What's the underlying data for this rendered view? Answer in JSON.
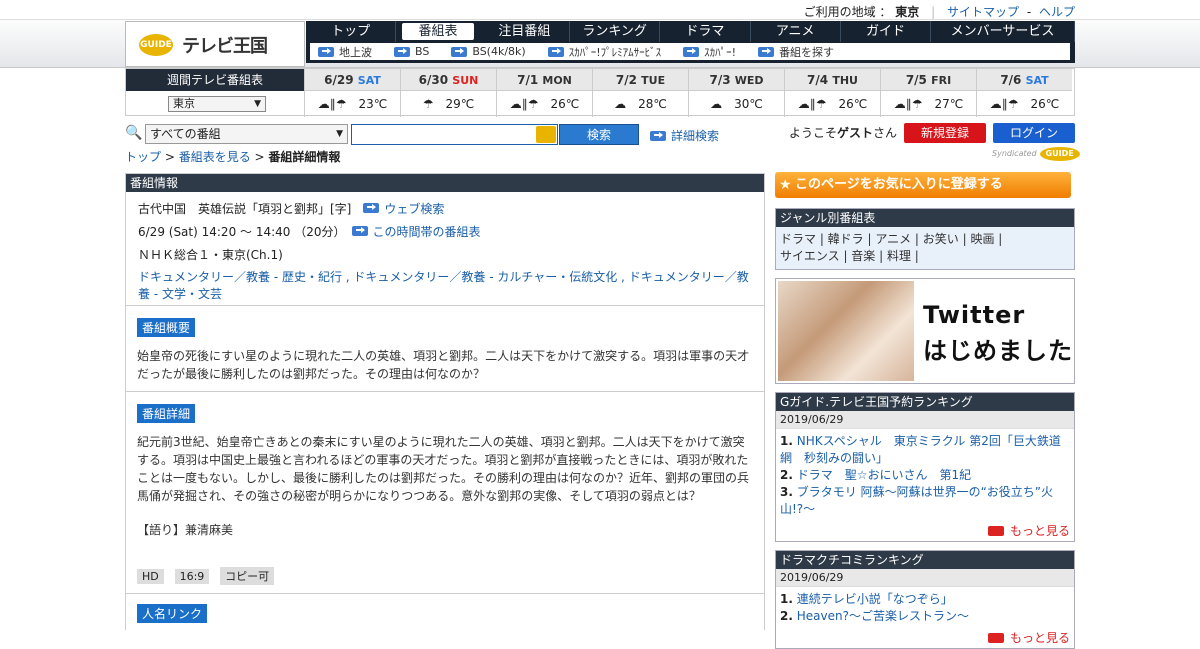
{
  "util": {
    "region_label": "ご利用の地域 ：",
    "region": "東京",
    "sitemap": "サイトマップ",
    "help": "ヘルプ"
  },
  "logo": {
    "g": "GUIDE",
    "text": "テレビ王国"
  },
  "nav": {
    "items": [
      "トップ",
      "番組表",
      "注目番組",
      "ランキング",
      "ドラマ",
      "アニメ",
      "ガイド",
      "メンバーサービス"
    ],
    "sub": [
      "地上波",
      "BS",
      "BS(4k/8k)",
      "ｽｶﾊﾟｰ!ﾌﾟﾚﾐｱﾑｻｰﾋﾞｽ",
      "ｽｶﾊﾟｰ!",
      "番組を探す"
    ]
  },
  "weekly": {
    "label": "週間テレビ番組表",
    "region": "東京",
    "days": [
      {
        "date": "6/29",
        "dow": "SAT",
        "weather": "☁∥☂",
        "temp": "23℃"
      },
      {
        "date": "6/30",
        "dow": "SUN",
        "weather": "☂",
        "temp": "29℃"
      },
      {
        "date": "7/1",
        "dow": "MON",
        "weather": "☁∥☂",
        "temp": "26℃"
      },
      {
        "date": "7/2",
        "dow": "TUE",
        "weather": "☁",
        "temp": "28℃"
      },
      {
        "date": "7/3",
        "dow": "WED",
        "weather": "☁",
        "temp": "30℃"
      },
      {
        "date": "7/4",
        "dow": "THU",
        "weather": "☁∥☂",
        "temp": "26℃"
      },
      {
        "date": "7/5",
        "dow": "FRI",
        "weather": "☁∥☂",
        "temp": "27℃"
      },
      {
        "date": "7/6",
        "dow": "SAT",
        "weather": "☁∥☂",
        "temp": "26℃"
      }
    ]
  },
  "search": {
    "select": "すべての番組",
    "button": "検索",
    "advanced": "詳細検索",
    "welcome": "ようこそ",
    "guest": "ゲスト",
    "san": "さん",
    "register": "新規登録",
    "login": "ログイン"
  },
  "crumb": {
    "top": "トップ",
    "list": "番組表を見る",
    "current": "番組詳細情報"
  },
  "syndicated": "Syndicated",
  "program": {
    "header": "番組情報",
    "title": "古代中国　英雄伝説「項羽と劉邦」[字]",
    "web_search": "ウェブ検索",
    "time": "6/29 (Sat) 14:20 ～ 14:40 （20分）",
    "timeslot": "この時間帯の番組表",
    "channel": "ＮＨＫ総合１・東京(Ch.1)",
    "genre": "ドキュメンタリー／教養 - 歴史・紀行 , ドキュメンタリー／教養 - カルチャー・伝統文化 , ドキュメンタリー／教養 - 文学・文芸",
    "summary_label": "番組概要",
    "summary": "始皇帝の死後にすい星のように現れた二人の英雄、項羽と劉邦。二人は天下をかけて激突する。項羽は軍事の天才だったが最後に勝利したのは劉邦だった。その理由は何なのか？",
    "detail_label": "番組詳細",
    "detail": "紀元前3世紀、始皇帝亡きあとの秦末にすい星のように現れた二人の英雄、項羽と劉邦。二人は天下をかけて激突する。項羽は中国史上最強と言われるほどの軍事の天才だった。項羽と劉邦が直接戦ったときには、項羽が敗れたことは一度もない。しかし、最後に勝利したのは劉邦だった。その勝利の理由は何なのか？近年、劉邦の軍団の兵馬俑が発掘され、その強さの秘密が明らかになりつつある。意外な劉邦の実像、そして項羽の弱点とは？",
    "narr": "【語り】兼清麻美",
    "tags": [
      "HD",
      "16:9",
      "コピー可"
    ],
    "person_label": "人名リンク"
  },
  "side": {
    "fav": "このページをお気に入りに登録する",
    "genre_header": "ジャンル別番組表",
    "genres1": "ドラマ | 韓ドラ | アニメ | お笑い | 映画 |",
    "genres2": "サイエンス | 音楽 | 料理 |",
    "twitter1": "Twitter",
    "twitter2": "はじめました",
    "rank_header": "Gガイド.テレビ王国予約ランキング",
    "rank_date": "2019/06/29",
    "rank": [
      "NHKスペシャル　東京ミラクル 第2回「巨大鉄道網　秒刻みの闘い」",
      "ドラマ　聖☆おにいさん　第1紀",
      "ブラタモリ 阿蘇〜阿蘇は世界一の“お役立ち”火山!?〜"
    ],
    "more": "もっと見る",
    "drama_header": "ドラマクチコミランキング",
    "drama_date": "2019/06/29",
    "drama": [
      "連続テレビ小説「なつぞら」",
      "Heaven?～ご苦楽レストラン～"
    ]
  }
}
